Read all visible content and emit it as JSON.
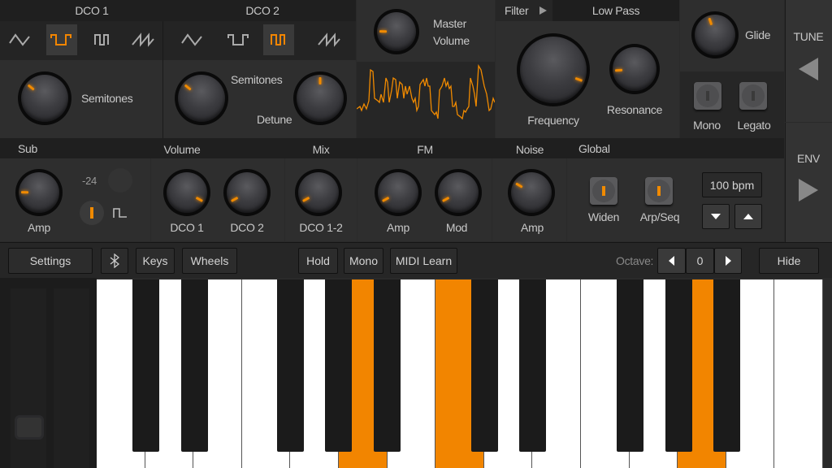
{
  "accent_color": "#f28500",
  "dco1": {
    "title": "DCO 1",
    "waveforms": [
      "triangle-wave-icon",
      "square-wave-icon",
      "pulse-wave-icon",
      "sawtooth-wave-icon"
    ],
    "selected": 1,
    "semitones_label": "Semitones",
    "semitones": 0.31
  },
  "dco2": {
    "title": "DCO 2",
    "selected": 2,
    "semitones_label": "Semitones",
    "semitones": 0.31,
    "detune_label": "Detune",
    "detune": 0.5
  },
  "master": {
    "label_line1": "Master",
    "label_line2": "Volume",
    "value": 0.17
  },
  "filter": {
    "title": "Filter",
    "type": "Low Pass",
    "frequency_label": "Frequency",
    "frequency": 0.91,
    "resonance_label": "Resonance",
    "resonance": 0.15
  },
  "glide": {
    "label": "Glide",
    "value": 0.43,
    "mono_label": "Mono",
    "mono_on": false,
    "legato_label": "Legato",
    "legato_on": false
  },
  "side": {
    "tune": "TUNE",
    "env": "ENV"
  },
  "sub": {
    "title": "Sub",
    "amp_label": "Amp",
    "amp": 0.17,
    "octave_value": "-24",
    "square_on": true
  },
  "volume": {
    "title": "Volume",
    "dco1_label": "DCO 1",
    "dco1": 0.94,
    "dco2_label": "DCO 2",
    "dco2": 0.06
  },
  "mix": {
    "title": "Mix",
    "label": "DCO 1-2",
    "value": 0.06
  },
  "fm": {
    "title": "FM",
    "amp_label": "Amp",
    "amp": 0.06,
    "mod_label": "Mod",
    "mod": 0.06
  },
  "noise": {
    "title": "Noise",
    "amp_label": "Amp",
    "amp": 0.28
  },
  "global": {
    "title": "Global",
    "widen_label": "Widen",
    "widen_on": true,
    "arp_label": "Arp/Seq",
    "arp_on": true,
    "tempo": "100 bpm"
  },
  "toolbar": {
    "settings": "Settings",
    "keys": "Keys",
    "wheels": "Wheels",
    "hold": "Hold",
    "mono": "Mono",
    "midi_learn": "MIDI Learn",
    "octave_label": "Octave:",
    "octave_value": "0",
    "hide": "Hide"
  },
  "keyboard": {
    "white_keys": [
      "C",
      "D",
      "E",
      "F",
      "G",
      "A",
      "B",
      "C",
      "D",
      "E",
      "F",
      "G",
      "A",
      "B",
      "C"
    ],
    "pressed_white": [
      5,
      7,
      12
    ],
    "pressed_black": []
  }
}
